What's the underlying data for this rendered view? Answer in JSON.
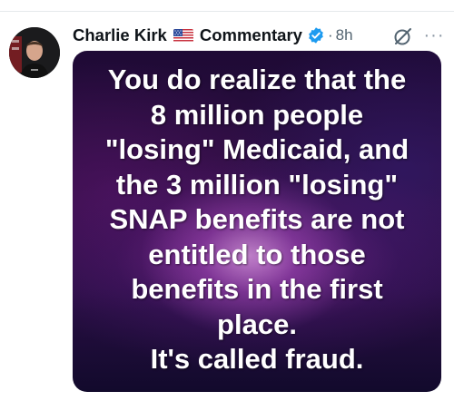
{
  "post": {
    "author_name": "Charlie Kirk",
    "community": "Commentary",
    "separator": "·",
    "time_ago": "8h",
    "more_label": "···"
  },
  "media": {
    "lines": [
      "You do realize that the",
      "8 million people",
      "\"losing\" Medicaid, and",
      "the 3 million \"losing\"",
      "SNAP benefits are not",
      "entitled to those",
      "benefits in the first",
      "place.",
      "It's called fraud."
    ]
  },
  "icons": {
    "flag": "us-flag-icon",
    "verified": "verified-badge-icon",
    "grok": "grok-icon",
    "more": "more-options-icon"
  },
  "colors": {
    "verified_blue": "#1d9bf0",
    "text_primary": "#0f1419",
    "text_secondary": "#536471"
  }
}
